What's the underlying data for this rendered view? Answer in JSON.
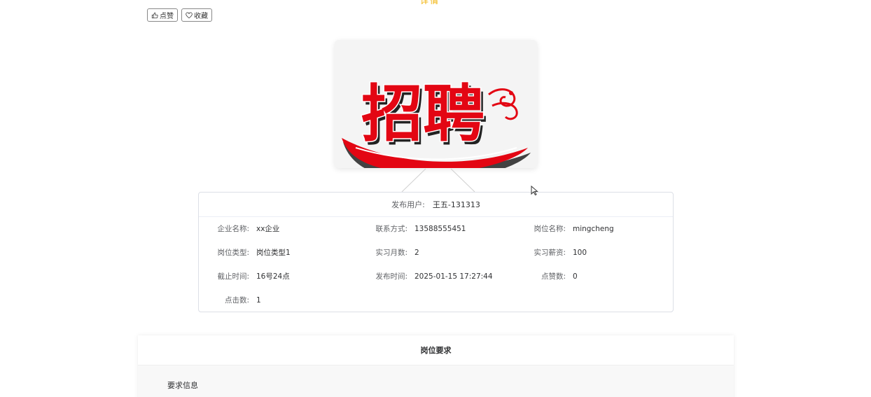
{
  "header": {
    "title_fragment": "详情"
  },
  "actions": {
    "like_label": "点赞",
    "favorite_label": "收藏"
  },
  "cover": {
    "text": "招聘"
  },
  "job_info": {
    "publisher_label": "发布用户:",
    "publisher_value": "王五-131313",
    "fields": [
      {
        "label": "企业名称:",
        "value": "xx企业"
      },
      {
        "label": "联系方式:",
        "value": "13588555451"
      },
      {
        "label": "岗位名称:",
        "value": "mingcheng"
      },
      {
        "label": "岗位类型:",
        "value": "岗位类型1"
      },
      {
        "label": "实习月数:",
        "value": "2"
      },
      {
        "label": "实习薪资:",
        "value": "100"
      },
      {
        "label": "截止时间:",
        "value": "16号24点"
      },
      {
        "label": "发布时间:",
        "value": "2025-01-15 17:27:44"
      },
      {
        "label": "点赞数:",
        "value": "0"
      },
      {
        "label": "点击数:",
        "value": "1"
      }
    ]
  },
  "requirements": {
    "section_title": "岗位要求",
    "info_label": "要求信息"
  },
  "colors": {
    "accent": "#f0b000",
    "border": "#dcdfe6",
    "cover_red": "#e30613"
  }
}
